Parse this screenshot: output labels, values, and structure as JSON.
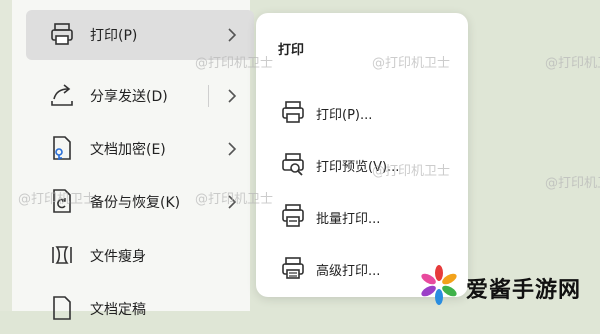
{
  "menu": {
    "items": [
      {
        "label": "打印(P)",
        "icon": "printer-icon",
        "active": true,
        "has_submenu": true
      },
      {
        "label": "分享发送(D)",
        "icon": "share-icon",
        "active": false,
        "has_submenu": true
      },
      {
        "label": "文档加密(E)",
        "icon": "document-lock-icon",
        "active": false,
        "has_submenu": true
      },
      {
        "label": "备份与恢复(K)",
        "icon": "backup-restore-icon",
        "active": false,
        "has_submenu": true
      },
      {
        "label": "文件瘦身",
        "icon": "file-slim-icon",
        "active": false,
        "has_submenu": false
      },
      {
        "label": "文档定稿",
        "icon": "document-finalize-icon",
        "active": false,
        "has_submenu": false
      }
    ]
  },
  "submenu": {
    "title": "打印",
    "items": [
      {
        "label": "打印(P)...",
        "icon": "printer-icon"
      },
      {
        "label": "打印预览(V)...",
        "icon": "print-preview-icon"
      },
      {
        "label": "批量打印...",
        "icon": "batch-print-icon"
      },
      {
        "label": "高级打印...",
        "icon": "advanced-print-icon"
      }
    ]
  },
  "watermark": {
    "text": "@打印机卫士"
  },
  "logo": {
    "text": "爱酱手游网"
  },
  "colors": {
    "active_bg": "#dedede",
    "panel_bg": "#ffffff",
    "page_bg": "#dfe6d6"
  }
}
